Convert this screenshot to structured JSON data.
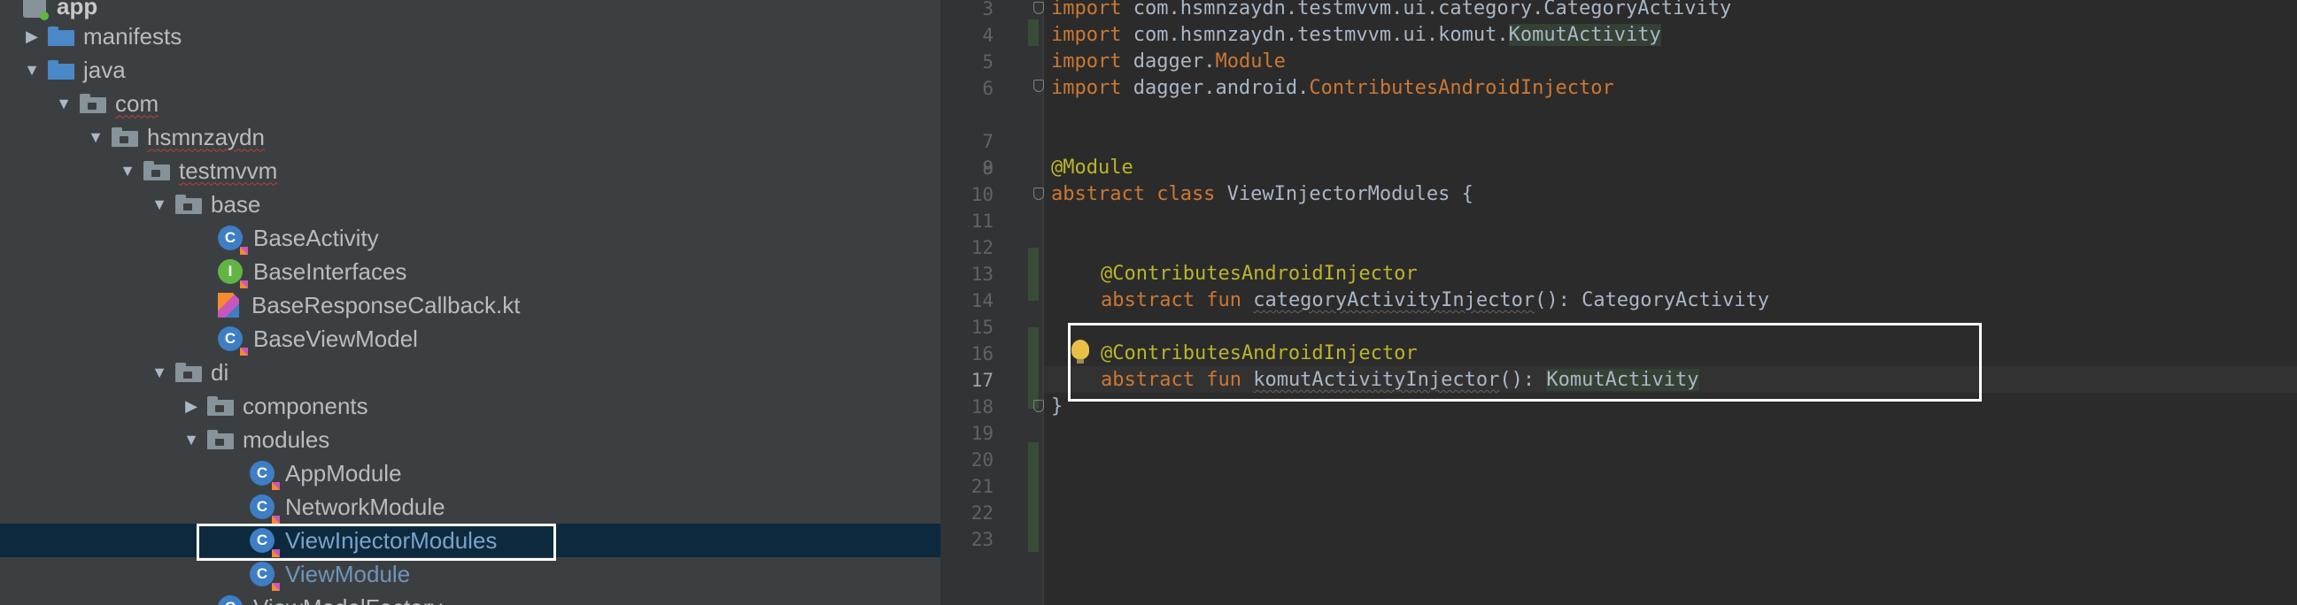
{
  "tree": {
    "items": [
      {
        "label": "app"
      },
      {
        "label": "manifests"
      },
      {
        "label": "java"
      },
      {
        "label": "com"
      },
      {
        "label": "hsmnzaydn"
      },
      {
        "label": "testmvvm"
      },
      {
        "label": "base"
      },
      {
        "label": "BaseActivity"
      },
      {
        "label": "BaseInterfaces"
      },
      {
        "label": "BaseResponseCallback.kt"
      },
      {
        "label": "BaseViewModel"
      },
      {
        "label": "di"
      },
      {
        "label": "components"
      },
      {
        "label": "modules"
      },
      {
        "label": "AppModule"
      },
      {
        "label": "NetworkModule"
      },
      {
        "label": "ViewInjectorModules"
      },
      {
        "label": "ViewModule"
      },
      {
        "label": "ViewModelFactory"
      }
    ]
  },
  "editor": {
    "line_numbers": [
      "3",
      "4",
      "5",
      "6",
      "7",
      "8",
      "9",
      "10",
      "11",
      "12",
      "13",
      "14",
      "15",
      "16",
      "17",
      "18",
      "19",
      "20",
      "21",
      "22",
      "23"
    ],
    "current_line": "17",
    "lines": {
      "l3": {
        "kw": "import",
        "rest": " com.hsmnzaydn.testmvvm.ui.category.CategoryActivity"
      },
      "l4": {
        "kw": "import",
        "rest": " com.hsmnzaydn.testmvvm.ui.komut.",
        "hl": "KomutActivity"
      },
      "l5": {
        "kw": "import",
        "rest": " dagger.",
        "typ": "Module"
      },
      "l6": {
        "kw": "import",
        "rest": " dagger.android.",
        "typ": "ContributesAndroidInjector"
      },
      "l9": {
        "ann": "@Module"
      },
      "l10": {
        "kw": "abstract class",
        "rest": " ViewInjectorModules {"
      },
      "l13": {
        "ann": "@ContributesAndroidInjector"
      },
      "l14": {
        "kw": "abstract fun",
        "fn": "categoryActivityInjector",
        "rest": "(): CategoryActivity"
      },
      "l16": {
        "ann": "@ContributesAndroidInjector"
      },
      "l17": {
        "kw": "abstract fun",
        "fn": "komutActivityInjector",
        "rest": "(): ",
        "hl": "KomutActivity"
      },
      "l18": {
        "rest": "}"
      }
    }
  },
  "icons": {
    "folder": "folder-icon",
    "package": "package-icon",
    "class": "kotlin-class-icon",
    "interface": "kotlin-interface-icon",
    "file": "kotlin-file-icon",
    "bulb": "lightbulb-icon"
  },
  "colors": {
    "tree_bg": "#3c3f41",
    "editor_bg": "#2b2b2b",
    "selection": "#0d293e",
    "keyword": "#cc7832",
    "annotation": "#bbb529",
    "text": "#a9b7c6"
  }
}
